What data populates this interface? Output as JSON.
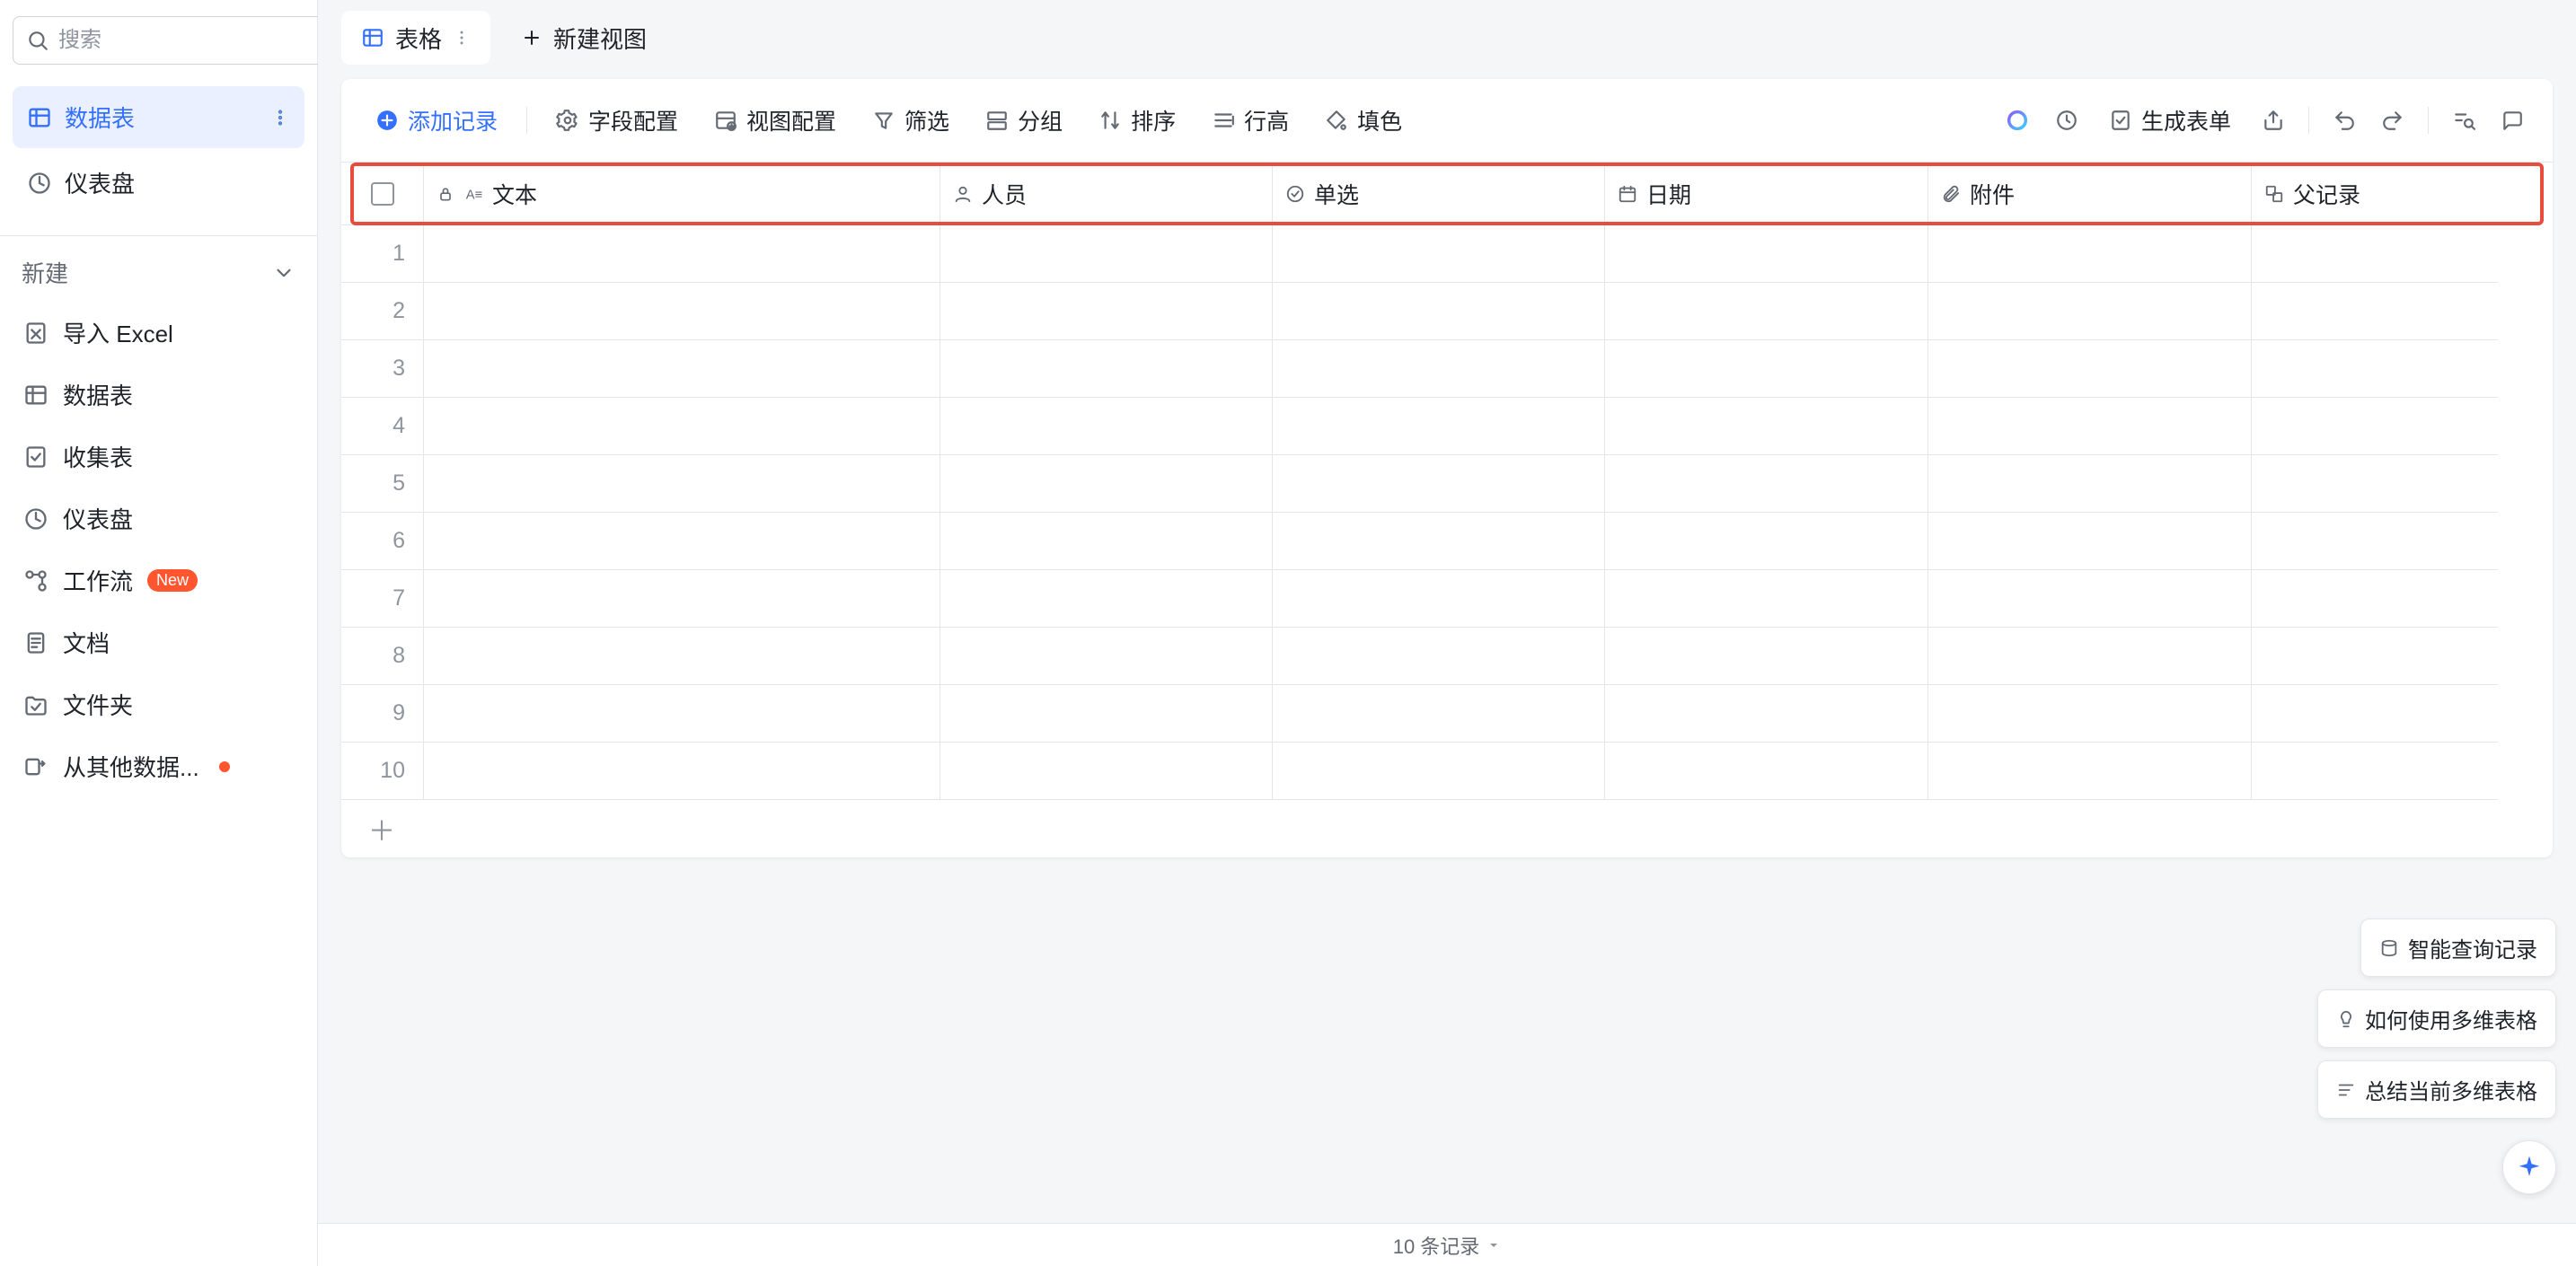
{
  "sidebar": {
    "search_placeholder": "搜索",
    "nav": [
      {
        "label": "数据表",
        "icon": "table-icon",
        "active": true
      },
      {
        "label": "仪表盘",
        "icon": "dashboard-icon",
        "active": false
      }
    ],
    "new_section_label": "新建",
    "new_items": [
      {
        "label": "导入 Excel",
        "icon": "excel-icon"
      },
      {
        "label": "数据表",
        "icon": "table-icon"
      },
      {
        "label": "收集表",
        "icon": "form-collect-icon"
      },
      {
        "label": "仪表盘",
        "icon": "dashboard-icon"
      },
      {
        "label": "工作流",
        "icon": "workflow-icon",
        "badge": "New"
      },
      {
        "label": "文档",
        "icon": "doc-icon"
      },
      {
        "label": "文件夹",
        "icon": "folder-icon"
      },
      {
        "label": "从其他数据...",
        "icon": "link-db-icon",
        "dot": true
      }
    ]
  },
  "tabs": {
    "active_label": "表格",
    "new_view_label": "新建视图"
  },
  "toolbar": {
    "add_record": "添加记录",
    "field_config": "字段配置",
    "view_config": "视图配置",
    "filter": "筛选",
    "group": "分组",
    "sort": "排序",
    "row_height": "行高",
    "fill": "填色",
    "generate_form": "生成表单"
  },
  "columns": [
    {
      "label": "文本",
      "icon": "text-field-icon",
      "locked": true
    },
    {
      "label": "人员",
      "icon": "person-icon"
    },
    {
      "label": "单选",
      "icon": "single-select-icon"
    },
    {
      "label": "日期",
      "icon": "date-icon"
    },
    {
      "label": "附件",
      "icon": "attachment-icon"
    },
    {
      "label": "父记录",
      "icon": "parent-record-icon"
    }
  ],
  "row_count": 10,
  "status": {
    "record_count_text": "10 条记录"
  },
  "help_chips": [
    "智能查询记录",
    "如何使用多维表格",
    "总结当前多维表格"
  ]
}
